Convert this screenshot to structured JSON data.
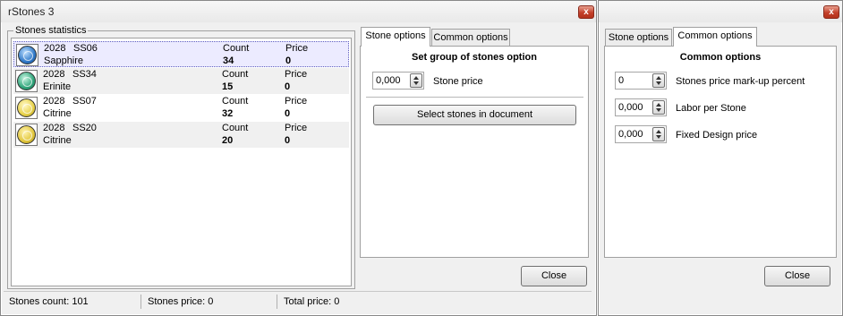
{
  "main_window": {
    "title": "rStones 3",
    "close_glyph": "x",
    "stones_group_label": "Stones statistics",
    "stones": [
      {
        "code": "2028",
        "size": "SS06",
        "name": "Sapphire",
        "count_label": "Count",
        "count": "34",
        "price_label": "Price",
        "price": "0",
        "color": "#2f78c8"
      },
      {
        "code": "2028",
        "size": "SS34",
        "name": "Erinite",
        "count_label": "Count",
        "count": "15",
        "price_label": "Price",
        "price": "0",
        "color": "#2fa57a"
      },
      {
        "code": "2028",
        "size": "SS07",
        "name": "Citrine",
        "count_label": "Count",
        "count": "32",
        "price_label": "Price",
        "price": "0",
        "color": "#e8d24a"
      },
      {
        "code": "2028",
        "size": "SS20",
        "name": "Citrine",
        "count_label": "Count",
        "count": "20",
        "price_label": "Price",
        "price": "0",
        "color": "#e1c63c"
      }
    ],
    "tabs": [
      "Stone options",
      "Common options"
    ],
    "stone_options": {
      "heading": "Set group of stones option",
      "stone_price_value": "0,000",
      "stone_price_label": "Stone price",
      "select_button": "Select stones in document"
    },
    "close_button": "Close",
    "status": {
      "stones_count": "Stones count: 101",
      "stones_price": "Stones price: 0",
      "total_price": "Total price: 0"
    }
  },
  "second_window": {
    "close_glyph": "x",
    "tabs": [
      "Stone options",
      "Common options"
    ],
    "common_options": {
      "heading": "Common options",
      "fields": [
        {
          "value": "0",
          "label": "Stones price mark-up percent"
        },
        {
          "value": "0,000",
          "label": "Labor per Stone"
        },
        {
          "value": "0,000",
          "label": "Fixed Design price"
        }
      ]
    },
    "close_button": "Close"
  },
  "colors": {
    "selected_row": "#ecebff",
    "window_bg": "#f0f0f0",
    "close_glyph_bg": "#c4402a"
  },
  "icons": {
    "gem": "stone-gem-icon",
    "close": "close-icon",
    "spin": "spin-updown-icon"
  }
}
